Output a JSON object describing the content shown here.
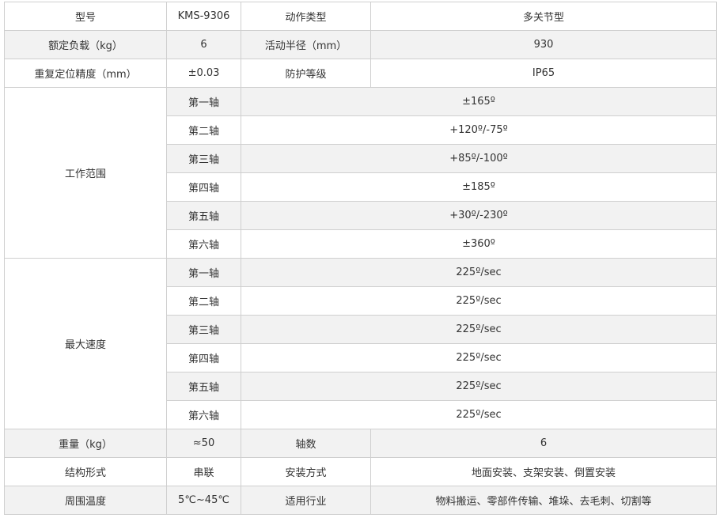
{
  "rows": {
    "model": {
      "label": "型号",
      "value": "KMS-9306",
      "label2": "动作类型",
      "value2": "多关节型"
    },
    "payload": {
      "label": "额定负载（kg）",
      "value": "6",
      "label2": "活动半径（mm）",
      "value2": "930"
    },
    "precision": {
      "label": "重复定位精度（mm）",
      "value": "±0.03",
      "label2": "防护等级",
      "value2": "IP65"
    },
    "weight": {
      "label": "重量（kg）",
      "value": "≈50",
      "label2": "轴数",
      "value2": "6"
    },
    "structure": {
      "label": "结构形式",
      "value": "串联",
      "label2": "安装方式",
      "value2": "地面安装、支架安装、倒置安装"
    },
    "ambient": {
      "label": "周围温度",
      "value": "5℃~45℃",
      "label2": "适用行业",
      "value2": "物料搬运、零部件传输、堆垛、去毛刺、切割等"
    }
  },
  "working_range": {
    "label": "工作范围",
    "axes": [
      {
        "axis": "第一轴",
        "value": "±165º"
      },
      {
        "axis": "第二轴",
        "value": "+120º/-75º"
      },
      {
        "axis": "第三轴",
        "value": "+85º/-100º"
      },
      {
        "axis": "第四轴",
        "value": "±185º"
      },
      {
        "axis": "第五轴",
        "value": "+30º/-230º"
      },
      {
        "axis": "第六轴",
        "value": "±360º"
      }
    ]
  },
  "max_speed": {
    "label": "最大速度",
    "axes": [
      {
        "axis": "第一轴",
        "value": "225º/sec"
      },
      {
        "axis": "第二轴",
        "value": "225º/sec"
      },
      {
        "axis": "第三轴",
        "value": "225º/sec"
      },
      {
        "axis": "第四轴",
        "value": "225º/sec"
      },
      {
        "axis": "第五轴",
        "value": "225º/sec"
      },
      {
        "axis": "第六轴",
        "value": "225º/sec"
      }
    ]
  }
}
